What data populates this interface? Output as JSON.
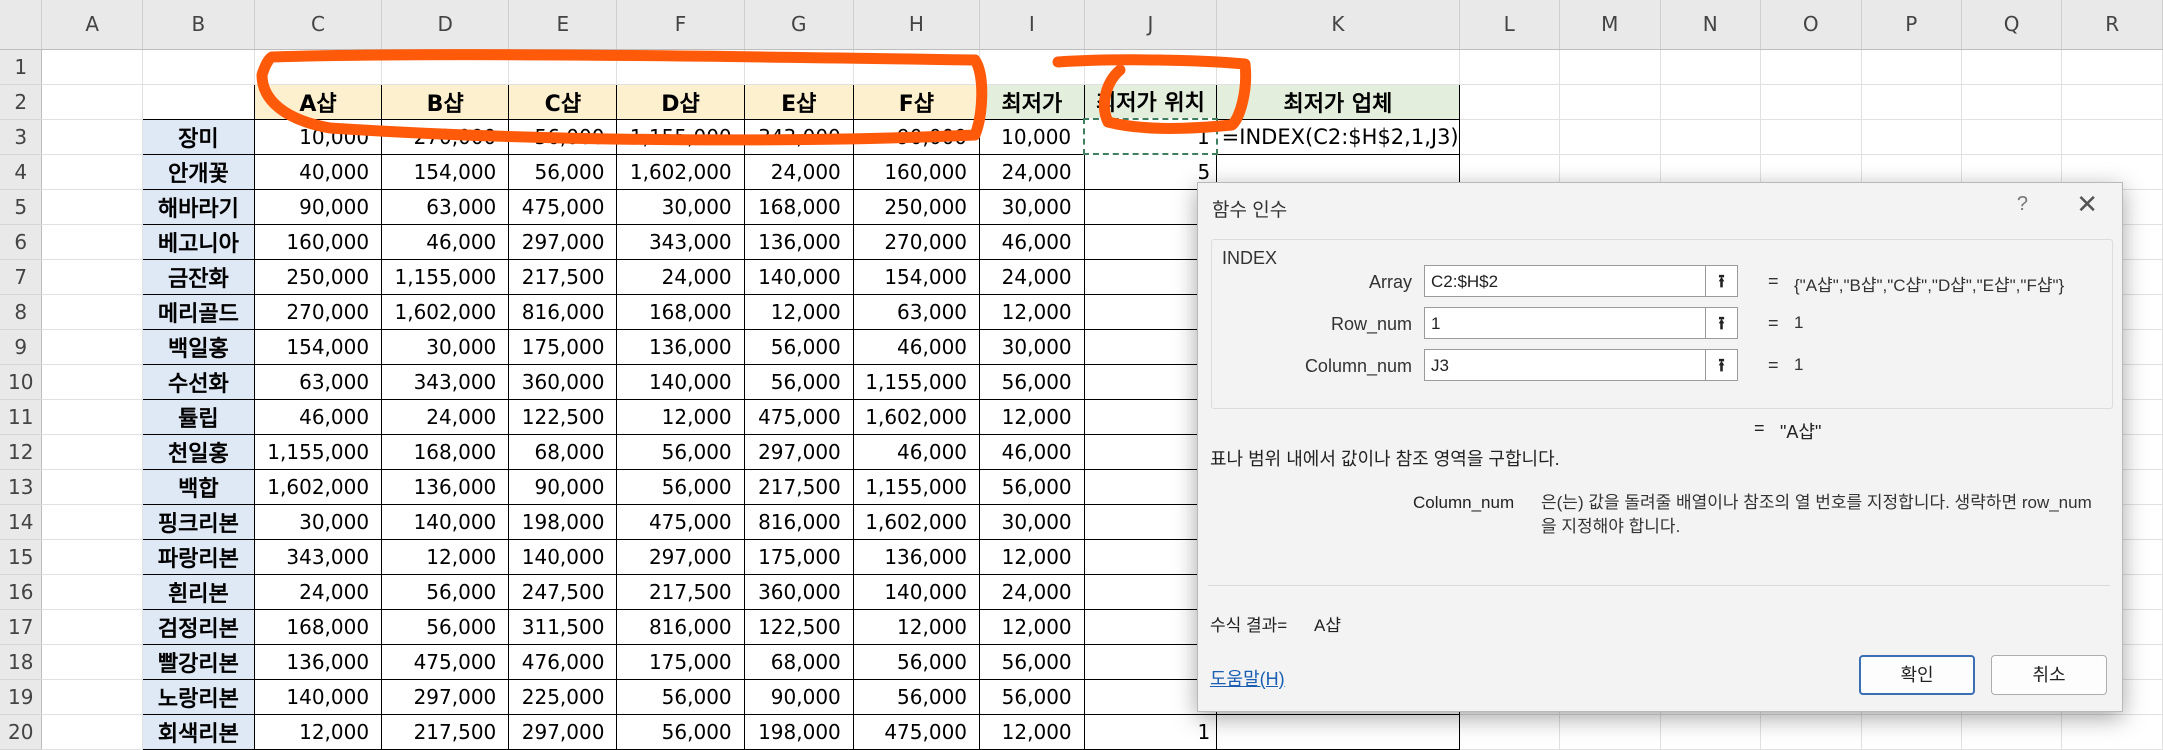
{
  "columns": [
    "A",
    "B",
    "C",
    "D",
    "E",
    "F",
    "G",
    "H",
    "I",
    "J",
    "K",
    "L",
    "M",
    "N",
    "O",
    "P",
    "Q",
    "R"
  ],
  "rows": [
    1,
    2,
    3,
    4,
    5,
    6,
    7,
    8,
    9,
    10,
    11,
    12,
    13,
    14,
    15,
    16,
    17,
    18,
    19,
    20
  ],
  "header_row": {
    "shops": [
      "A샵",
      "B샵",
      "C샵",
      "D샵",
      "E샵",
      "F샵"
    ],
    "min_price": "최저가",
    "min_pos": "최저가 위치",
    "min_vendor": "최저가 업체"
  },
  "table": [
    {
      "name": "장미",
      "values": [
        "10,000",
        "270,000",
        "56,000",
        "1,155,000",
        "343,000",
        "90,000"
      ],
      "min": "10,000",
      "pos": "1"
    },
    {
      "name": "안개꽃",
      "values": [
        "40,000",
        "154,000",
        "56,000",
        "1,602,000",
        "24,000",
        "160,000"
      ],
      "min": "24,000",
      "pos": "5"
    },
    {
      "name": "해바라기",
      "values": [
        "90,000",
        "63,000",
        "475,000",
        "30,000",
        "168,000",
        "250,000"
      ],
      "min": "30,000",
      "pos": ""
    },
    {
      "name": "베고니아",
      "values": [
        "160,000",
        "46,000",
        "297,000",
        "343,000",
        "136,000",
        "270,000"
      ],
      "min": "46,000",
      "pos": ""
    },
    {
      "name": "금잔화",
      "values": [
        "250,000",
        "1,155,000",
        "217,500",
        "24,000",
        "140,000",
        "154,000"
      ],
      "min": "24,000",
      "pos": ""
    },
    {
      "name": "메리골드",
      "values": [
        "270,000",
        "1,602,000",
        "816,000",
        "168,000",
        "12,000",
        "63,000"
      ],
      "min": "12,000",
      "pos": ""
    },
    {
      "name": "백일홍",
      "values": [
        "154,000",
        "30,000",
        "175,000",
        "136,000",
        "56,000",
        "46,000"
      ],
      "min": "30,000",
      "pos": ""
    },
    {
      "name": "수선화",
      "values": [
        "63,000",
        "343,000",
        "360,000",
        "140,000",
        "56,000",
        "1,155,000"
      ],
      "min": "56,000",
      "pos": ""
    },
    {
      "name": "튤립",
      "values": [
        "46,000",
        "24,000",
        "122,500",
        "12,000",
        "475,000",
        "1,602,000"
      ],
      "min": "12,000",
      "pos": ""
    },
    {
      "name": "천일홍",
      "values": [
        "1,155,000",
        "168,000",
        "68,000",
        "56,000",
        "297,000",
        "46,000"
      ],
      "min": "46,000",
      "pos": ""
    },
    {
      "name": "백합",
      "values": [
        "1,602,000",
        "136,000",
        "90,000",
        "56,000",
        "217,500",
        "1,155,000"
      ],
      "min": "56,000",
      "pos": ""
    },
    {
      "name": "핑크리본",
      "values": [
        "30,000",
        "140,000",
        "198,000",
        "475,000",
        "816,000",
        "1,602,000"
      ],
      "min": "30,000",
      "pos": ""
    },
    {
      "name": "파랑리본",
      "values": [
        "343,000",
        "12,000",
        "140,000",
        "297,000",
        "175,000",
        "136,000"
      ],
      "min": "12,000",
      "pos": ""
    },
    {
      "name": "흰리본",
      "values": [
        "24,000",
        "56,000",
        "247,500",
        "217,500",
        "360,000",
        "140,000"
      ],
      "min": "24,000",
      "pos": ""
    },
    {
      "name": "검정리본",
      "values": [
        "168,000",
        "56,000",
        "311,500",
        "816,000",
        "122,500",
        "12,000"
      ],
      "min": "12,000",
      "pos": ""
    },
    {
      "name": "빨강리본",
      "values": [
        "136,000",
        "475,000",
        "476,000",
        "175,000",
        "68,000",
        "56,000"
      ],
      "min": "56,000",
      "pos": ""
    },
    {
      "name": "노랑리본",
      "values": [
        "140,000",
        "297,000",
        "225,000",
        "56,000",
        "90,000",
        "56,000"
      ],
      "min": "56,000",
      "pos": ""
    },
    {
      "name": "회색리본",
      "values": [
        "12,000",
        "217,500",
        "297,000",
        "56,000",
        "198,000",
        "475,000"
      ],
      "min": "12,000",
      "pos": "1"
    }
  ],
  "formula_cell": "=INDEX(C2:$H$2,1,J3)",
  "dialog": {
    "title": "함수 인수",
    "help_glyph": "?",
    "close_glyph": "✕",
    "function_name": "INDEX",
    "args": [
      {
        "label": "Array",
        "value": "C2:$H$2",
        "result": "{\"A샵\",\"B샵\",\"C샵\",\"D샵\",\"E샵\",\"F샵\"}"
      },
      {
        "label": "Row_num",
        "value": "1",
        "result": "1"
      },
      {
        "label": "Column_num",
        "value": "J3",
        "result": "1"
      }
    ],
    "equals": "=",
    "overall_result": "\"A샵\"",
    "description": "표나 범위 내에서 값이나 참조 영역을 구합니다.",
    "param_name": "Column_num",
    "param_desc": "은(는) 값을 돌려줄 배열이나 참조의 열 번호를 지정합니다. 생략하면 row_num을 지정해야 합니다.",
    "formula_result_label": "수식 결과=",
    "formula_result_value": "A샵",
    "help_link": "도움말(H)",
    "ok": "확인",
    "cancel": "취소"
  },
  "colors": {
    "annotation": "#ff5a0a",
    "shop_header": "#fdf0cf",
    "min_header": "#e3efdc",
    "name_col": "#dfe8f5"
  }
}
